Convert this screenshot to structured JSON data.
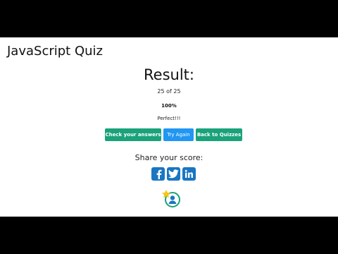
{
  "quiz": {
    "title": "JavaScript Quiz"
  },
  "result": {
    "heading": "Result:",
    "score": "25 of 25",
    "percent": "100%",
    "message": "Perfect!!!"
  },
  "buttons": {
    "check_answers": "Check your answers",
    "try_again": "Try Again",
    "back_to_quizzes": "Back to Quizzes"
  },
  "share": {
    "label": "Share your score:",
    "icons": [
      "facebook-icon",
      "twitter-icon",
      "linkedin-icon"
    ]
  },
  "badge": {
    "icon": "user-star-badge-icon"
  },
  "colors": {
    "primary_button": "#1aa27a",
    "secondary_button": "#2196f3",
    "social": "#1976c2",
    "badge_ring": "#1aa27a",
    "badge_star": "#f5c518"
  }
}
